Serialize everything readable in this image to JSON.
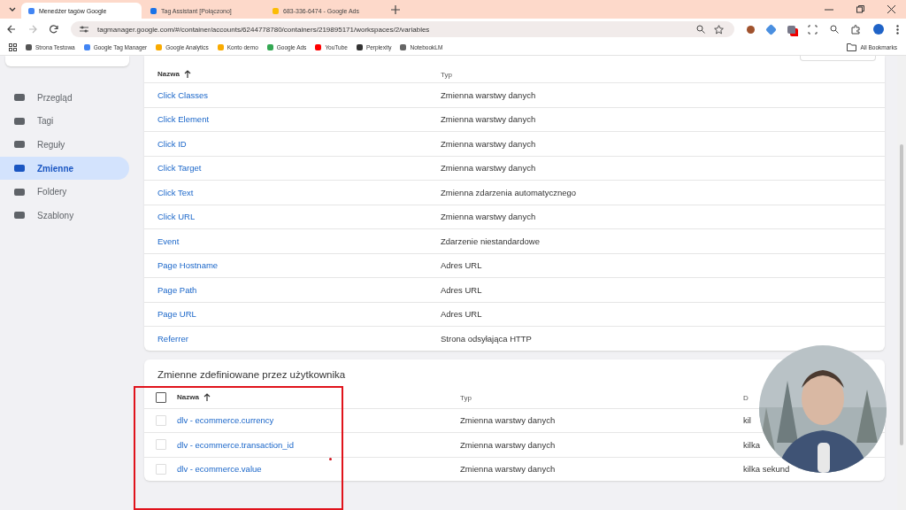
{
  "browser": {
    "tabs": [
      {
        "title": "Menedżer tagów Google",
        "selected": true
      },
      {
        "title": "Tag Assistant [Połączono]",
        "selected": false
      },
      {
        "title": "683-336-6474 - Google Ads",
        "selected": false
      }
    ],
    "url": "tagmanager.google.com/#/container/accounts/6244778780/containers/219895171/workspaces/2/variables",
    "bookmarks": [
      "Strona Testowa",
      "Google Tag Manager",
      "Google Analytics",
      "Konto demo",
      "Google Ads",
      "YouTube",
      "Perplexity",
      "NotebookLM"
    ],
    "all_bookmarks": "All Bookmarks"
  },
  "sidebar": {
    "items": [
      {
        "label": "Przegląd",
        "selected": false
      },
      {
        "label": "Tagi",
        "selected": false
      },
      {
        "label": "Reguły",
        "selected": false
      },
      {
        "label": "Zmienne",
        "selected": true
      },
      {
        "label": "Foldery",
        "selected": false
      },
      {
        "label": "Szablony",
        "selected": false
      }
    ]
  },
  "builtin_table": {
    "columns": {
      "name": "Nazwa",
      "type": "Typ"
    },
    "rows": [
      {
        "name": "Click Classes",
        "type": "Zmienna warstwy danych"
      },
      {
        "name": "Click Element",
        "type": "Zmienna warstwy danych"
      },
      {
        "name": "Click ID",
        "type": "Zmienna warstwy danych"
      },
      {
        "name": "Click Target",
        "type": "Zmienna warstwy danych"
      },
      {
        "name": "Click Text",
        "type": "Zmienna zdarzenia automatycznego"
      },
      {
        "name": "Click URL",
        "type": "Zmienna warstwy danych"
      },
      {
        "name": "Event",
        "type": "Zdarzenie niestandardowe"
      },
      {
        "name": "Page Hostname",
        "type": "Adres URL"
      },
      {
        "name": "Page Path",
        "type": "Adres URL"
      },
      {
        "name": "Page URL",
        "type": "Adres URL"
      },
      {
        "name": "Referrer",
        "type": "Strona odsyłająca HTTP"
      }
    ]
  },
  "user_table": {
    "title": "Zmienne zdefiniowane przez użytkownika",
    "all_checked": false,
    "columns": {
      "name": "Nazwa",
      "type": "Typ",
      "column_3": "D"
    },
    "rows": [
      {
        "checked": false,
        "name": "dlv - ecommerce.currency",
        "type": "Zmienna warstwy danych",
        "column_3": "kil"
      },
      {
        "checked": false,
        "name": "dlv - ecommerce.transaction_id",
        "type": "Zmienna warstwy danych",
        "column_3": "kilka"
      },
      {
        "checked": false,
        "name": "dlv - ecommerce.value",
        "type": "Zmienna warstwy danych",
        "column_3": "kilka sekund"
      }
    ]
  }
}
